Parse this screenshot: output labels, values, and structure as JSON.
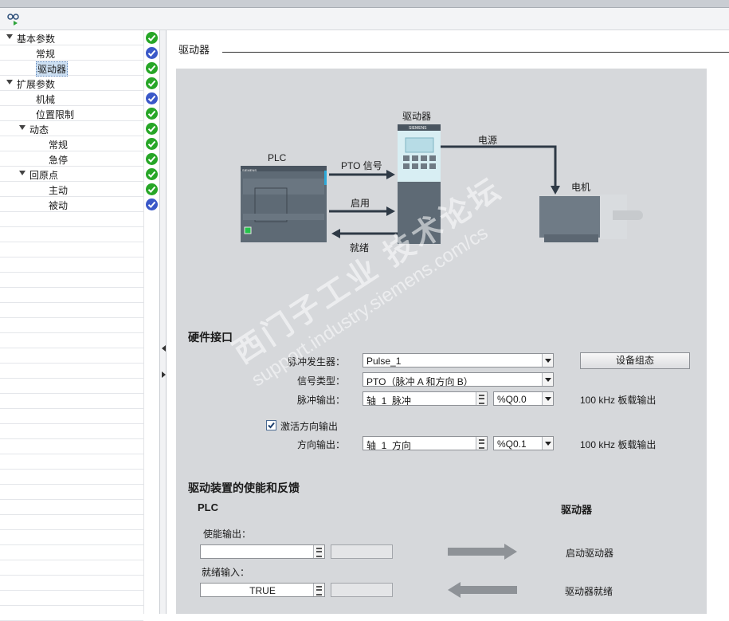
{
  "toolbar": {
    "icon": "glasses-run-icon"
  },
  "nav": {
    "items": [
      {
        "label": "基本参数",
        "level": 0,
        "expanded": true,
        "status": "ok"
      },
      {
        "label": "常规",
        "level": 1,
        "status": "info"
      },
      {
        "label": "驱动器",
        "level": 1,
        "status": "ok",
        "selected": true
      },
      {
        "label": "扩展参数",
        "level": 0,
        "expanded": true,
        "status": "ok"
      },
      {
        "label": "机械",
        "level": 1,
        "status": "info"
      },
      {
        "label": "位置限制",
        "level": 1,
        "status": "ok"
      },
      {
        "label": "动态",
        "level": 1,
        "expanded": true,
        "status": "ok"
      },
      {
        "label": "常规",
        "level": 2,
        "status": "ok"
      },
      {
        "label": "急停",
        "level": 2,
        "status": "ok"
      },
      {
        "label": "回原点",
        "level": 1,
        "expanded": true,
        "status": "ok"
      },
      {
        "label": "主动",
        "level": 2,
        "status": "ok"
      },
      {
        "label": "被动",
        "level": 2,
        "status": "info"
      }
    ]
  },
  "section": {
    "title": "驱动器"
  },
  "diagram": {
    "plc_label": "PLC",
    "plc_brand": "SIEMENS",
    "drive_label": "驱动器",
    "drive_brand": "SIEMENS",
    "motor_label": "电机",
    "power_label": "电源",
    "pto_label": "PTO 信号",
    "enable_label": "启用",
    "ready_label": "就绪"
  },
  "hardware": {
    "title": "硬件接口",
    "pulse_gen_label": "脉冲发生器：",
    "pulse_gen_value": "Pulse_1",
    "device_config_button": "设备组态",
    "signal_type_label": "信号类型：",
    "signal_type_value": "PTO（脉冲 A 和方向 B）",
    "pulse_out_label": "脉冲输出：",
    "pulse_out_value": "轴_1_脉冲",
    "pulse_out_addr": "%Q0.0",
    "pulse_out_note": "100 kHz 板载输出",
    "dir_enable_label": "激活方向输出",
    "dir_enable_checked": true,
    "dir_out_label": "方向输出：",
    "dir_out_value": "轴_1_方向",
    "dir_out_addr": "%Q0.1",
    "dir_out_note": "100 kHz 板载输出"
  },
  "enable": {
    "title": "驱动装置的使能和反馈",
    "plc_header": "PLC",
    "drive_header": "驱动器",
    "enable_out_label": "使能输出：",
    "enable_out_value": "",
    "start_drive_label": "启动驱动器",
    "ready_in_label": "就绪输入：",
    "ready_in_value": "TRUE",
    "drive_ready_label": "驱动器就绪"
  },
  "watermark": {
    "line1": "西门子工业  技术论坛",
    "line2": "support.industry.siemens.com/cs"
  },
  "colors": {
    "ok": "#27a627",
    "info": "#3a58c8",
    "panel": "#d6d8db",
    "plc": "#5e6a75",
    "drive_top": "#d8eef3"
  }
}
